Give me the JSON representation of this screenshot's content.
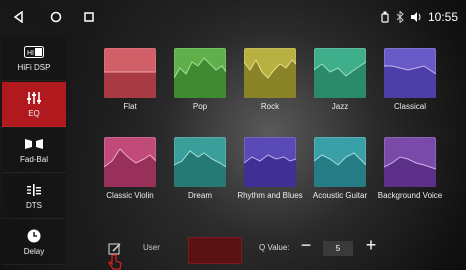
{
  "status": {
    "time": "10:55"
  },
  "sidebar": {
    "items": [
      {
        "label": "HiFi DSP",
        "icon": "hifi-icon",
        "active": false
      },
      {
        "label": "EQ",
        "icon": "equalizer-icon",
        "active": true
      },
      {
        "label": "Fad-Bal",
        "icon": "fader-balance-icon",
        "active": false
      },
      {
        "label": "DTS",
        "icon": "dts-icon",
        "active": false
      },
      {
        "label": "Delay",
        "icon": "clock-icon",
        "active": false
      }
    ]
  },
  "presets": {
    "row1": [
      {
        "label": "Flat",
        "color": "#c8505a"
      },
      {
        "label": "Pop",
        "color": "#5fb04a"
      },
      {
        "label": "Rock",
        "color": "#b8b040"
      },
      {
        "label": "Jazz",
        "color": "#3fae8a"
      },
      {
        "label": "Classical",
        "color": "#6a5ac8"
      }
    ],
    "row2": [
      {
        "label": "Classic Violin",
        "color": "#c04a78"
      },
      {
        "label": "Dream",
        "color": "#3a9e9a"
      },
      {
        "label": "Rhythm and Blues",
        "color": "#5a4ab8"
      },
      {
        "label": "Acoustic Guitar",
        "color": "#3aa0a8"
      },
      {
        "label": "Background Voice",
        "color": "#7a4aa8"
      }
    ]
  },
  "bottom": {
    "user_label": "User",
    "q_label": "Q Value:",
    "q_value": "5",
    "minus": "−",
    "plus": "+"
  }
}
